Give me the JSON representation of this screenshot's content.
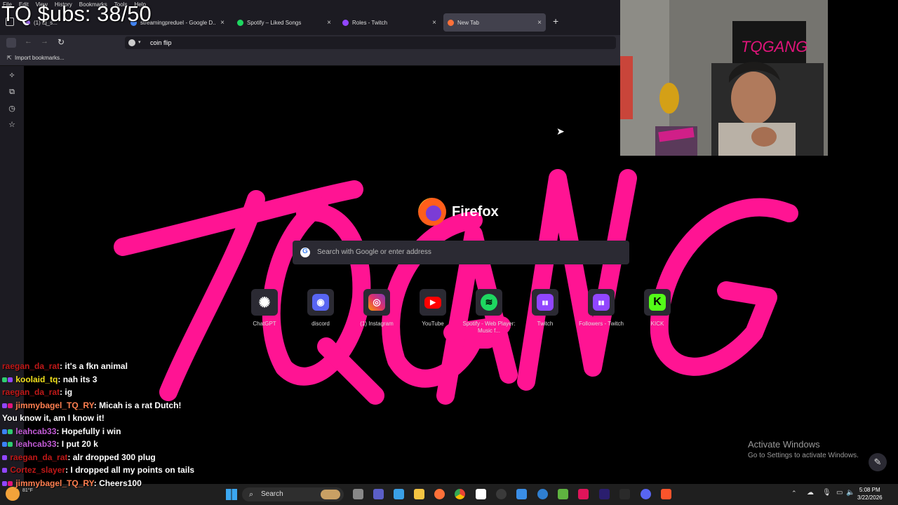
{
  "menubar": {
    "items": [
      "File",
      "Edit",
      "View",
      "History",
      "Bookmarks",
      "Tools",
      "Help"
    ]
  },
  "tabs": [
    {
      "title": "(1) tq_s...",
      "color": "#a970ff",
      "active": false
    },
    {
      "title": "streamingpredueI - Google D...",
      "color": "#4285f4",
      "active": false
    },
    {
      "title": "Spotify – Liked Songs",
      "color": "#1ed760",
      "active": false
    },
    {
      "title": "Roles - Twitch",
      "color": "#9146ff",
      "active": false
    },
    {
      "title": "New Tab",
      "color": "#ff7139",
      "active": true
    }
  ],
  "tab_close_glyph": "×",
  "new_tab_glyph": "+",
  "navbar": {
    "url": "coin flip"
  },
  "bookmarks_bar": {
    "import_label": "Import bookmarks..."
  },
  "newtab": {
    "brand": "Firefox",
    "search_placeholder": "Search with Google or enter address",
    "shortcuts": [
      {
        "label": "ChatGPT",
        "icon": "chatgpt-icon",
        "glyph": "✺",
        "color": "#2b2a33"
      },
      {
        "label": "discord",
        "icon": "discord-icon",
        "glyph": "◉",
        "color": "#5865f2"
      },
      {
        "label": "(1) Instagram",
        "icon": "instagram-icon",
        "glyph": "◎",
        "color": "#e1306c"
      },
      {
        "label": "YouTube",
        "icon": "youtube-icon",
        "glyph": "▶",
        "color": "#ff0000"
      },
      {
        "label": "Spotify - Web Player: Music f...",
        "icon": "spotify-icon",
        "glyph": "≋",
        "color": "#1ed760"
      },
      {
        "label": "Twitch",
        "icon": "twitch-icon",
        "glyph": "▮▮",
        "color": "#9146ff"
      },
      {
        "label": "Followers - Twitch",
        "icon": "twitch-icon",
        "glyph": "▮▮",
        "color": "#9146ff"
      },
      {
        "label": "KICK",
        "icon": "kick-icon",
        "glyph": "K",
        "color": "#53fc18"
      }
    ],
    "background_text": "TQGANG"
  },
  "stream_overlay": {
    "sub_goal": "TQ $ubs: 38/50"
  },
  "chat": [
    {
      "user": "raegan_da_rat",
      "user_color": "#c01818",
      "msg": "it's a fkn animal"
    },
    {
      "user": "koolaid_tq",
      "user_color": "#f2e21c",
      "msg": "nah its 3"
    },
    {
      "user": "raegan_da_rat",
      "user_color": "#c01818",
      "msg": "ig"
    },
    {
      "user": "jimmybagel_TQ_RY",
      "user_color": "#ff7f50",
      "msg": "Micah is a rat Dutch! You know it, am I know it!"
    },
    {
      "user": "leahcab33",
      "user_color": "#c25bd6",
      "msg": "Hopefully i win"
    },
    {
      "user": "leahcab33",
      "user_color": "#c25bd6",
      "msg": "I put 20 k"
    },
    {
      "user": "raegan_da_rat",
      "user_color": "#c01818",
      "msg": "alr dropped 300 plug"
    },
    {
      "user": "Cortez_slayer",
      "user_color": "#c01818",
      "msg": "I dropped all my points on tails"
    },
    {
      "user": "jimmybagel_TQ_RY",
      "user_color": "#ff7f50",
      "msg": "Cheers100"
    }
  ],
  "watermark": {
    "title": "Activate Windows",
    "subtitle": "Go to Settings to activate Windows."
  },
  "taskbar": {
    "search_label": "Search",
    "time": "5:08 PM",
    "date": "3/22/2026",
    "weather_temp": "81°F"
  },
  "colors": {
    "brand_pink": "#ff1493",
    "ui_dark": "#1c1b22",
    "ui_mid": "#2b2a33"
  }
}
